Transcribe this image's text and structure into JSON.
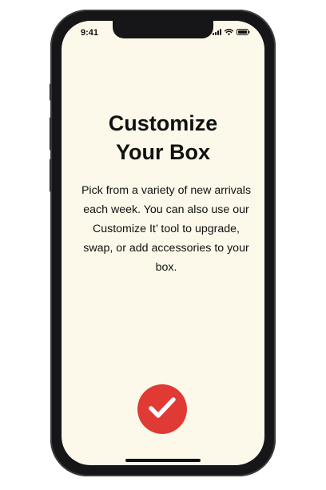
{
  "status_bar": {
    "time": "9:41",
    "icons": [
      "signal-icon",
      "wifi-icon",
      "battery-icon"
    ]
  },
  "onboarding": {
    "title": "Customize\nYour Box",
    "body": "Pick from a variety of new arrivals each week. You can also use our Customize It’ tool to upgrade, swap, or add accessories to your box.",
    "confirm_icon": "checkmark-icon"
  },
  "colors": {
    "screen_background": "#fcf8ea",
    "accent": "#e03a34",
    "text": "#111111",
    "device_frame": "#161618"
  }
}
